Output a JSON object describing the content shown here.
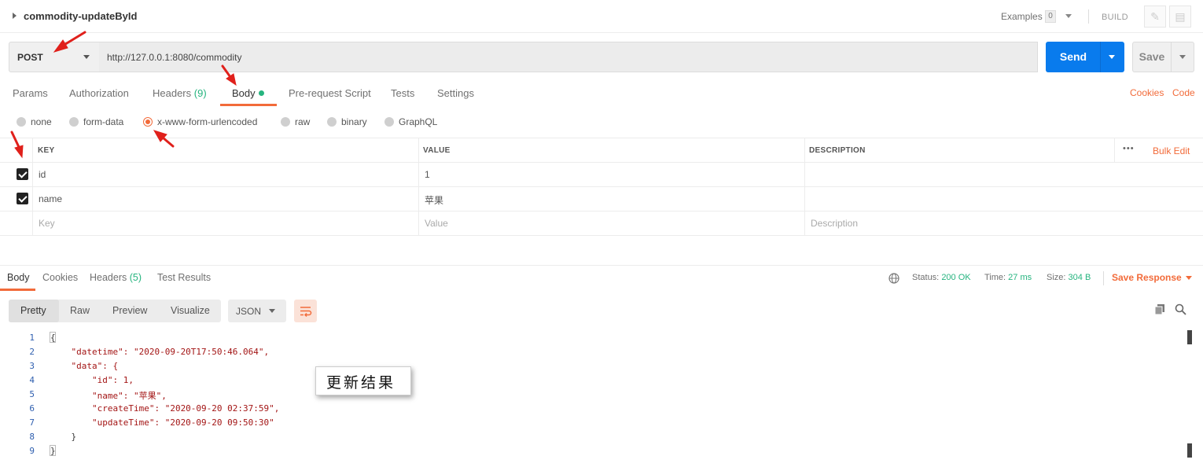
{
  "request": {
    "name": "commodity-updateById",
    "method": "POST",
    "url": "http://127.0.0.1:8080/commodity",
    "send_label": "Send",
    "save_label": "Save"
  },
  "header": {
    "examples_label": "Examples",
    "examples_count": "0",
    "build_label": "BUILD"
  },
  "request_tabs": [
    {
      "label": "Params",
      "count": ""
    },
    {
      "label": "Authorization",
      "count": ""
    },
    {
      "label": "Headers",
      "count": "(9)"
    },
    {
      "label": "Body",
      "count": ""
    },
    {
      "label": "Pre-request Script",
      "count": ""
    },
    {
      "label": "Tests",
      "count": ""
    },
    {
      "label": "Settings",
      "count": ""
    }
  ],
  "right_links": {
    "cookies": "Cookies",
    "code": "Code"
  },
  "body_types": [
    {
      "label": "none",
      "selected": false
    },
    {
      "label": "form-data",
      "selected": false
    },
    {
      "label": "x-www-form-urlencoded",
      "selected": true
    },
    {
      "label": "raw",
      "selected": false
    },
    {
      "label": "binary",
      "selected": false
    },
    {
      "label": "GraphQL",
      "selected": false
    }
  ],
  "kv_table": {
    "headers": {
      "key": "KEY",
      "value": "VALUE",
      "description": "DESCRIPTION"
    },
    "more_label": "•••",
    "bulk_edit": "Bulk Edit",
    "rows": [
      {
        "checked": true,
        "key": "id",
        "value": "1",
        "description": ""
      },
      {
        "checked": true,
        "key": "name",
        "value": "苹果",
        "description": ""
      }
    ],
    "placeholders": {
      "key": "Key",
      "value": "Value",
      "description": "Description"
    }
  },
  "response": {
    "tabs": [
      {
        "label": "Body",
        "count": ""
      },
      {
        "label": "Cookies",
        "count": ""
      },
      {
        "label": "Headers",
        "count": "(5)"
      },
      {
        "label": "Test Results",
        "count": ""
      }
    ],
    "status_label": "Status:",
    "status_value": "200 OK",
    "time_label": "Time:",
    "time_value": "27 ms",
    "size_label": "Size:",
    "size_value": "304 B",
    "save_response": "Save Response",
    "view_modes": [
      "Pretty",
      "Raw",
      "Preview",
      "Visualize"
    ],
    "format": "JSON",
    "code_lines": [
      {
        "n": "1",
        "text": "{"
      },
      {
        "n": "2",
        "text": "    \"datetime\": \"2020-09-20T17:50:46.064\","
      },
      {
        "n": "3",
        "text": "    \"data\": {"
      },
      {
        "n": "4",
        "text": "        \"id\": 1,"
      },
      {
        "n": "5",
        "text": "        \"name\": \"苹果\","
      },
      {
        "n": "6",
        "text": "        \"createTime\": \"2020-09-20 02:37:59\","
      },
      {
        "n": "7",
        "text": "        \"updateTime\": \"2020-09-20 09:50:30\""
      },
      {
        "n": "8",
        "text": "    }"
      },
      {
        "n": "9",
        "text": "}"
      }
    ]
  },
  "annotation": {
    "callout": "更新结果",
    "arrow_color": "#e0201b"
  },
  "colors": {
    "accent": "#f26b3a",
    "send": "#097bed",
    "success": "#26b47f"
  }
}
